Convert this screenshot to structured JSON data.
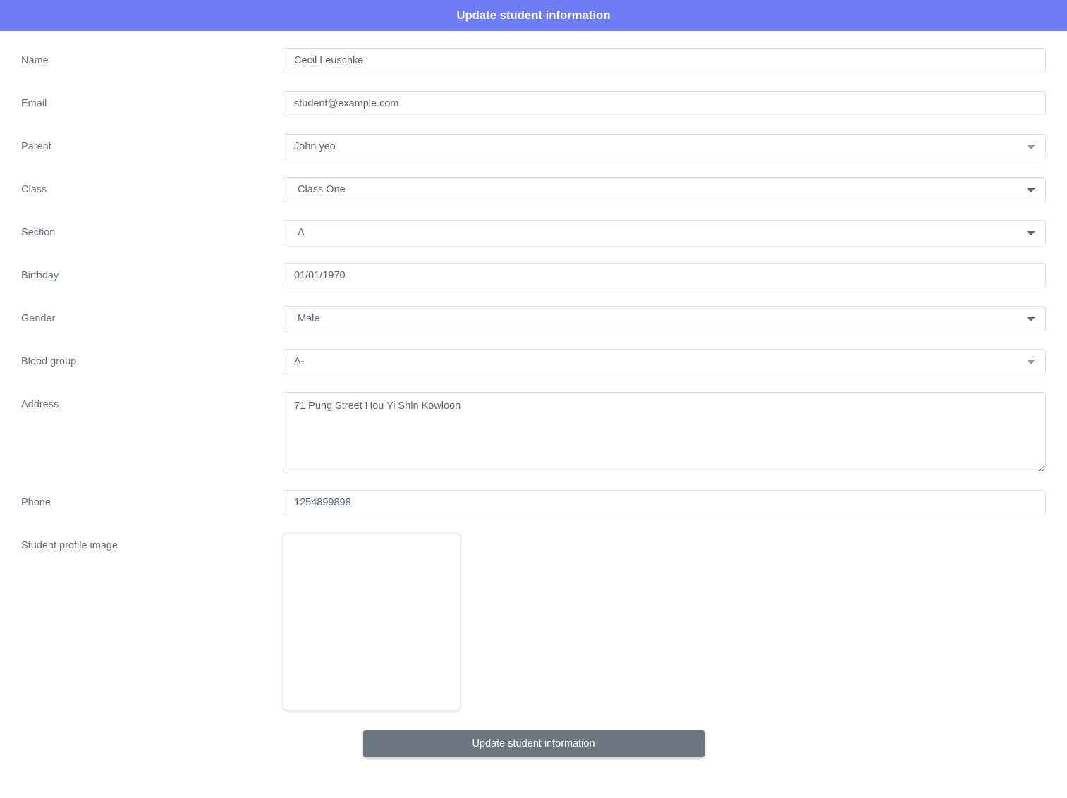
{
  "header": {
    "title": "Update student information",
    "background_color": "#717df5",
    "text_color": "#ffffff"
  },
  "theme": {
    "page_background": "#ffffff",
    "label_color": "#69737f",
    "value_color": "#5a6572",
    "input_border_color": "#dfe3e8",
    "dropdown_arrow_color": "#8d9aa8",
    "submit_color": "#6c757d"
  },
  "form": {
    "fields": [
      {
        "label": "Name",
        "value": "Cecil Leuschke",
        "placeholder": "Name"
      },
      {
        "label": "Email",
        "value": "student@example.com",
        "placeholder": "Email"
      },
      {
        "label": "Parent",
        "value": "John yeo"
      },
      {
        "label": "Class",
        "value": "Class One",
        "options": [
          "Class One"
        ]
      },
      {
        "label": "Section",
        "value": "A",
        "options": [
          "A"
        ]
      },
      {
        "label": "Birthday",
        "value": "01/01/1970",
        "placeholder": "Birthday"
      },
      {
        "label": "Gender",
        "value": "Male",
        "options": [
          "Male"
        ]
      },
      {
        "label": "Blood group",
        "value": "A-"
      },
      {
        "label": "Address",
        "value": "71 Pung Street Hou Yi Shin Kowloon",
        "placeholder": "Address"
      },
      {
        "label": "Phone",
        "value": "1254899898",
        "placeholder": "Phone"
      },
      {
        "label": "Student profile image",
        "value": ""
      }
    ]
  },
  "submit": {
    "label": "Update student information"
  }
}
